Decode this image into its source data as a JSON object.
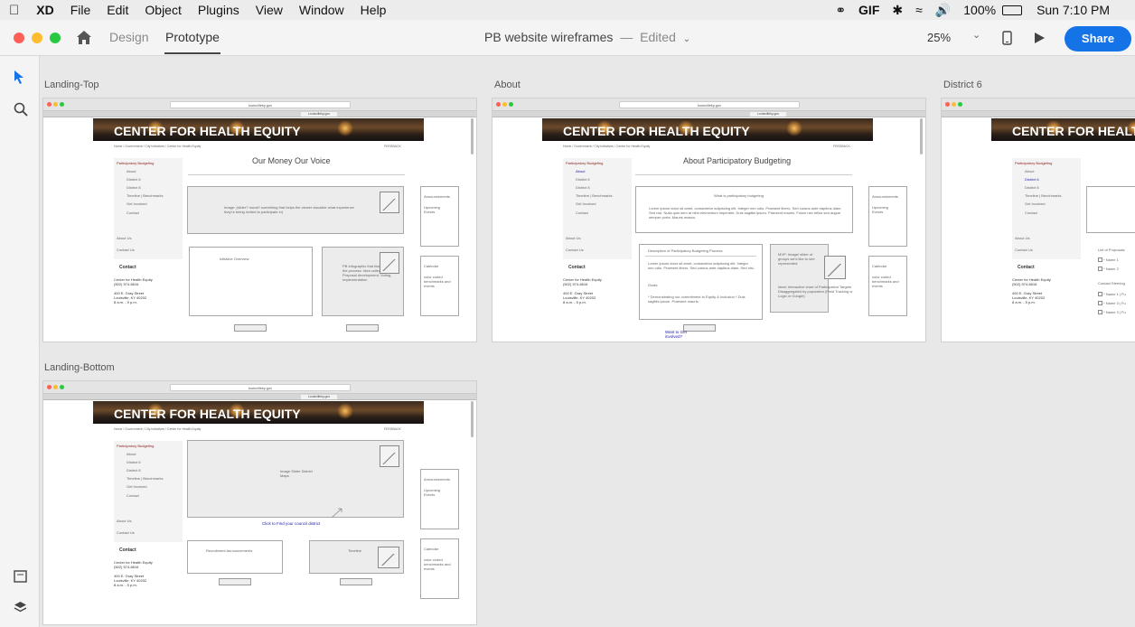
{
  "menubar": {
    "app_name": "XD",
    "items": [
      "File",
      "Edit",
      "Object",
      "Plugins",
      "View",
      "Window",
      "Help"
    ],
    "gif_label": "GIF",
    "battery": "100%",
    "clock": "Sun 7:10 PM"
  },
  "titlebar": {
    "tab_design": "Design",
    "tab_prototype": "Prototype",
    "document_title": "PB website wireframes",
    "separator": "—",
    "status": "Edited",
    "zoom": "25%",
    "share_label": "Share"
  },
  "artboards": {
    "landing_top": {
      "label": "Landing-Top",
      "url": "louisvilleky.gov",
      "tab_url": "Louisvilleky.gov",
      "banner_title": "CENTER FOR HEALTH EQUITY",
      "breadcrumb": "Home  /  Government  /  City Initiatives  /  Center for Health Equity",
      "feedback": "FEEDBACK",
      "page_title": "Our Money Our Voice",
      "sidebar": [
        "Participatory Budgeting",
        "About",
        "District 6",
        "District 8",
        "Timeline | Benchmarks",
        "Get Involved",
        "Contact",
        "About Us",
        "Contact Us"
      ],
      "contact_heading": "Contact",
      "contact_lines": [
        "Center for Health Equity",
        "(502) 574-6616",
        "400 E. Gray Street",
        "Louisville, KY 40202",
        "8 a.m. - 5 p.m."
      ],
      "hero_text": "Image: (slider? mural? something that helps the viewer visualize what experience they're being invited to participate in)",
      "initiative_overview": "Initiative Overview",
      "infographic_text": "PB Infographic that illustrates the process: Idea collection, Proposal development, Voting, Implementation",
      "announcements": "Announcements",
      "upcoming_events": "Upcoming Events",
      "calendar": "Calendar",
      "calendar_note": "color coded benchmarks and events"
    },
    "about": {
      "label": "About",
      "url": "louisvilleky.gov",
      "tab_url": "Louisvilleky.gov",
      "banner_title": "CENTER FOR HEALTH EQUITY",
      "breadcrumb": "Home  /  Government  /  City Initiatives  /  Center for Health Equity",
      "feedback": "FEEDBACK",
      "page_title": "About Participatory Budgeting",
      "sidebar": [
        "Participatory Budgeting",
        "About",
        "District 6",
        "District 8",
        "Timeline | Benchmarks",
        "Get Involved",
        "Contact",
        "About Us",
        "Contact Us"
      ],
      "contact_heading": "Contact",
      "contact_lines": [
        "Center for Health Equity",
        "(502) 574-6616",
        "400 E. Gray Street",
        "Louisville, KY 40202",
        "8 a.m. - 5 p.m."
      ],
      "what_is_heading": "What is participatory budgeting",
      "what_is_body": "Lorem ipsum dolor sit amet, consectetur adipiscing elit. Integer nec odio. Praesent libero. Sed cursus ante dapibus diam. Sed nisi. Nulla quis sem at nibh elementum imperdiet. Duis sagittis ipsum. Praesent mauris. Fusce nec tellus sed augue semper porta. Mauris massa.",
      "description_heading": "Description of Participatory Budgeting Process",
      "description_body": "Lorem ipsum dolor sit amet, consectetur adipiscing elit. Integer nec odio. Praesent libero. Sed cursus ante dapibus diam. Sed nisi.",
      "goals_heading": "Goals",
      "goals_body": "* Demonstrating our commitment to Equity & Inclusion  * Duis sagittis ipsum. Praesent mauris.",
      "mvp_text": "MVP: Image/ slider of groups we'd like to see represented",
      "ideal_text": "Ideal: Interactive chart of Participation Targets Disaggregated by population (Field Tracking w Logic or Google)",
      "want_to": "Want to Get involved?",
      "announcements": "Announcements",
      "upcoming_events": "Upcoming Events",
      "calendar": "Calendar",
      "calendar_note": "color coded benchmarks and events"
    },
    "district6": {
      "label": "District 6",
      "banner_title": "CENTER FOR HEALTH EQUITY",
      "sidebar": [
        "Participatory Budgeting",
        "About",
        "District 6",
        "District 8",
        "Timeline | Benchmarks",
        "Get Involved",
        "Contact",
        "About Us",
        "Contact Us"
      ],
      "contact_heading": "Contact",
      "contact_lines": [
        "Center for Health Equity",
        "(502) 574-6616",
        "400 E. Gray Street",
        "Louisville, KY 40202",
        "8 a.m. - 5 p.m."
      ],
      "proposals_heading": "List of Proposals",
      "proposals": [
        "Name 1",
        "Name 2"
      ],
      "steering_heading": "Contact Steering",
      "steering": [
        "Name 1 | Fu",
        "Name 3 | Fu",
        "Name 3 | Fu"
      ]
    },
    "landing_bottom": {
      "label": "Landing-Bottom",
      "url": "louisvilleky.gov",
      "tab_url": "Louisvilleky.gov",
      "banner_title": "CENTER FOR HEALTH EQUITY",
      "breadcrumb": "Home  /  Government  /  City Initiatives  /  Center for Health Equity",
      "feedback": "FEEDBACK",
      "sidebar": [
        "Participatory Budgeting",
        "About",
        "District 6",
        "District 8",
        "Timeline | Benchmarks",
        "Get Involved",
        "Contact",
        "About Us",
        "Contact Us"
      ],
      "contact_heading": "Contact",
      "contact_lines": [
        "Center for Health Equity",
        "(502) 574-6616",
        "400 E. Gray Street",
        "Louisville, KY 40202",
        "8 a.m. - 5 p.m."
      ],
      "slider_text": "Image Slider District Maps",
      "find_district": "Click to Find your council district",
      "recruitment": "Recruitment Announcements",
      "timeline": "Timeline",
      "announcements": "Announcements",
      "upcoming_events": "Upcoming Events",
      "calendar": "Calendar",
      "calendar_note": "color coded benchmarks and events"
    }
  },
  "colors": {
    "share": "#1473e6",
    "traffic_red": "#fe5f57",
    "traffic_yellow": "#febc2e",
    "traffic_green": "#28c840",
    "selection_blue": "#1473e6"
  }
}
